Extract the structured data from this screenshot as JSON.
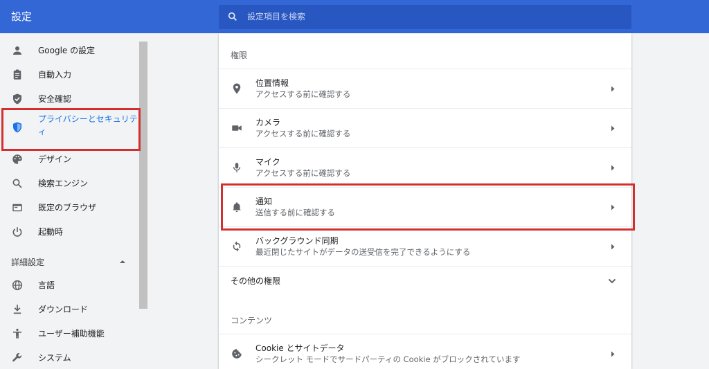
{
  "header": {
    "title": "設定",
    "search_placeholder": "設定項目を検索"
  },
  "sidebar": {
    "items": [
      {
        "label": "Google の設定",
        "icon": "person-icon"
      },
      {
        "label": "自動入力",
        "icon": "clipboard-icon"
      },
      {
        "label": "安全確認",
        "icon": "shield-check-icon"
      },
      {
        "label": "プライバシーとセキュリティ",
        "icon": "shield-icon",
        "active": true
      },
      {
        "label": "デザイン",
        "icon": "palette-icon"
      },
      {
        "label": "検索エンジン",
        "icon": "search-icon"
      },
      {
        "label": "既定のブラウザ",
        "icon": "browser-icon"
      },
      {
        "label": "起動時",
        "icon": "power-icon"
      }
    ],
    "advanced_label": "詳細設定",
    "advanced_items": [
      {
        "label": "言語",
        "icon": "globe-icon"
      },
      {
        "label": "ダウンロード",
        "icon": "download-icon"
      },
      {
        "label": "ユーザー補助機能",
        "icon": "accessibility-icon"
      },
      {
        "label": "システム",
        "icon": "wrench-icon"
      }
    ]
  },
  "main": {
    "permissions_title": "権限",
    "permissions": [
      {
        "title": "位置情報",
        "desc": "アクセスする前に確認する",
        "icon": "location-icon"
      },
      {
        "title": "カメラ",
        "desc": "アクセスする前に確認する",
        "icon": "camera-icon"
      },
      {
        "title": "マイク",
        "desc": "アクセスする前に確認する",
        "icon": "mic-icon"
      },
      {
        "title": "通知",
        "desc": "送信する前に確認する",
        "icon": "bell-icon"
      },
      {
        "title": "バックグラウンド同期",
        "desc": "最近閉じたサイトがデータの送受信を完了できるようにする",
        "icon": "sync-icon"
      }
    ],
    "other_permissions": "その他の権限",
    "content_title": "コンテンツ",
    "cookie": {
      "title": "Cookie とサイトデータ",
      "desc": "シークレット モードでサードパーティの Cookie がブロックされています",
      "icon": "cookie-icon"
    }
  },
  "colors": {
    "header": "#3367d6",
    "accent": "#1a73e8",
    "highlight": "#d32f2f"
  }
}
